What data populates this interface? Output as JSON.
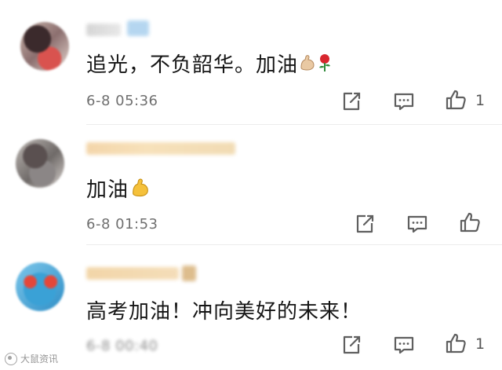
{
  "comments": [
    {
      "content": "追光，不负韶华。加油",
      "emojis": [
        "flexed-biceps",
        "rose"
      ],
      "time": "6-8 05:36",
      "likes": "1"
    },
    {
      "content": "加油",
      "emojis": [
        "flexed-biceps"
      ],
      "time": "6-8 01:53",
      "likes": ""
    },
    {
      "content": "高考加油！冲向美好的未来！",
      "emojis": [],
      "time": "6-8 00:40",
      "likes": "1"
    }
  ],
  "colors": {
    "text": "#151515",
    "meta": "#6f6f6f",
    "icon": "#5f5f5f",
    "emoji_yellow": "#f5c13b",
    "rose_red": "#d8262e"
  },
  "watermark": "大鼠资讯"
}
